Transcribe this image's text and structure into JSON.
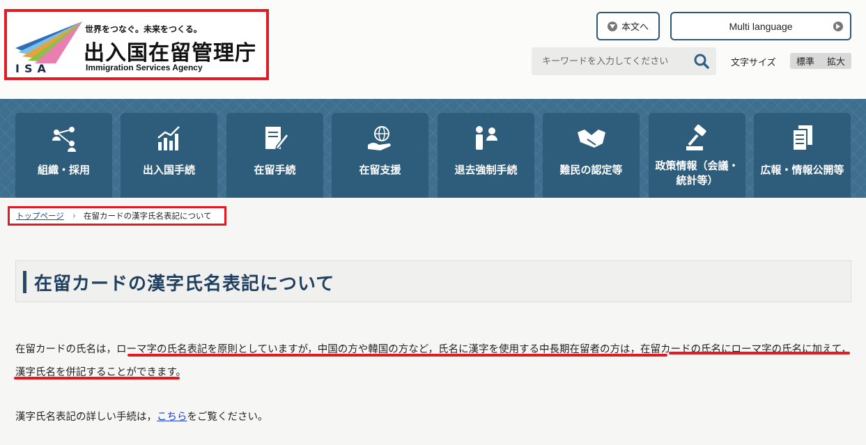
{
  "header": {
    "logo_isa": "ISA",
    "logo_tagline": "世界をつなぐ。未来をつくる。",
    "logo_title": "出入国在留管理庁",
    "logo_en": "Immigration Services Agency",
    "skip_label": "本文へ",
    "lang_label": "Multi language",
    "search_placeholder": "キーワードを入力してください",
    "font_size_label": "文字サイズ",
    "font_standard": "標準",
    "font_large": "拡大"
  },
  "nav": {
    "items": [
      {
        "label": "組織・採用",
        "icon": "people-network-icon"
      },
      {
        "label": "出入国手続",
        "icon": "chart-icon"
      },
      {
        "label": "在留手続",
        "icon": "document-pen-icon"
      },
      {
        "label": "在留支援",
        "icon": "globe-hand-icon"
      },
      {
        "label": "退去強制手続",
        "icon": "persons-icon"
      },
      {
        "label": "難民の認定等",
        "icon": "handshake-icon"
      },
      {
        "label": "政策情報（会議・統計等）",
        "icon": "gavel-icon"
      },
      {
        "label": "広報・情報公開等",
        "icon": "documents-icon"
      }
    ]
  },
  "breadcrumb": {
    "home": "トップページ",
    "current": "在留カードの漢字氏名表記について"
  },
  "page": {
    "title": "在留カードの漢字氏名表記について",
    "para1_a": "在留カードの氏名は，",
    "para1_b": "ローマ字の氏名表記を原則としていますが，中国の方や韓国の方など，氏名に漢字を使用する中長期在留者の方は，在留カードの氏名にローマ字",
    "para1_c": "の氏名に加えて，漢字氏名を併記",
    "para1_d": "することができます。",
    "para2_a": "漢字氏名表記の詳しい手続は，",
    "para2_link": "こちら",
    "para2_b": "をご覧ください。"
  },
  "colors": {
    "nav_bg": "#3f6f8f",
    "nav_item": "#2e5d7c",
    "highlight_red": "#e01b24",
    "title_color": "#1e3f5f"
  }
}
